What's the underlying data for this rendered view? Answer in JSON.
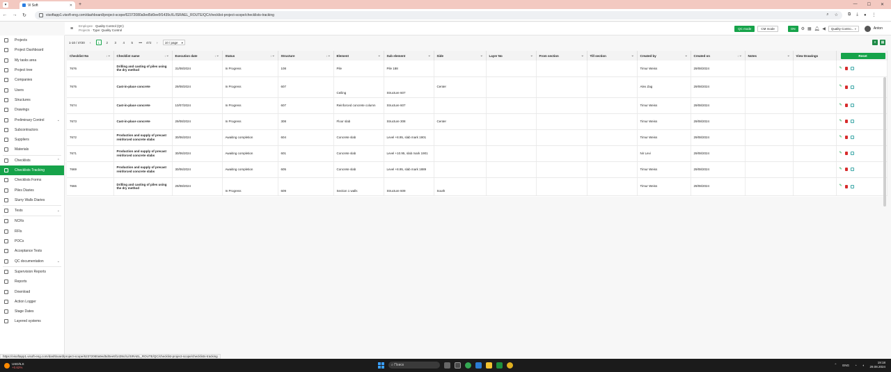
{
  "browser": {
    "tab_title": "Vi Soft",
    "url": "visoftapp1.visoft-eng.com/dashboard/project-scope/62372080a9ed5d0ee5f1439c/IL/ISRAEL_ROUTE/QC/checklist-project-scope/checklists-tracking",
    "status_url": "https://visoftapp1.visoft-eng.com/dashboard/project-scope/62372080a9ed5d0ee5f1439c/IL/ISRAEL_ROUTE/QC/checklist-project-scope/checklists-tracking"
  },
  "header": {
    "crumb_top_prefix": "Employee",
    "crumb_top": "Quality Control (QC)",
    "crumb_bottom_prefix": "Projects",
    "crumb_bottom": "Type: Quality Control",
    "qc_mode": "QC mode",
    "cm_mode": "CM mode",
    "on_label": "ON",
    "project_select": "Quality Contro...",
    "user": "Anton"
  },
  "sidebar": {
    "items": [
      {
        "label": "Projects"
      },
      {
        "label": "Project Dashboard"
      },
      {
        "label": "My tasks area"
      },
      {
        "label": "Project tree"
      },
      {
        "label": "Companies"
      },
      {
        "label": "Users"
      },
      {
        "label": "Structures"
      },
      {
        "label": "Drawings"
      },
      {
        "label": "Preliminary Control"
      },
      {
        "label": "Subcontractors"
      },
      {
        "label": "Suppliers"
      },
      {
        "label": "Materials"
      },
      {
        "label": "Checklists"
      },
      {
        "label": "Checklists Tracking"
      },
      {
        "label": "Checklists Forms"
      },
      {
        "label": "Piles Diaries"
      },
      {
        "label": "Slurry Walls Diaries"
      },
      {
        "label": "Tests"
      },
      {
        "label": "NCRs"
      },
      {
        "label": "RFIs"
      },
      {
        "label": "POCs"
      },
      {
        "label": "Acceptance Tests"
      },
      {
        "label": "QC documentation"
      },
      {
        "label": "Supervision Reports"
      },
      {
        "label": "Reports"
      },
      {
        "label": "Download"
      },
      {
        "label": "Action Logger"
      },
      {
        "label": "Stage Dates"
      },
      {
        "label": "Layered systems"
      }
    ]
  },
  "pagination": {
    "range": "1-10 / 4720",
    "pages": [
      "1",
      "2",
      "3",
      "4",
      "5",
      "•••",
      "472"
    ],
    "page_size": "10 / page"
  },
  "table": {
    "headers": [
      "Checklist No",
      "Checklist name",
      "Execution date",
      "Status",
      "Structure",
      "Element",
      "Sub element",
      "Side",
      "Layer No",
      "From section",
      "Till section",
      "Created by",
      "Created on",
      "Notes",
      "View Drawings"
    ],
    "reset_label": "Reset",
    "rows": [
      {
        "no": "7676",
        "name": "Drilling and casting of piles using the dry method",
        "date": "31/08/2024",
        "status": "In Progress",
        "structure": "108",
        "element": "Pile",
        "sub": "Pile 188",
        "side": "",
        "layer": "",
        "from": "",
        "till": "",
        "by": "Timur Weiss",
        "on": "29/08/2024",
        "notes": ""
      },
      {
        "no": "7675",
        "name": "Cast-in-place concrete",
        "date": "29/08/2024",
        "status": "In Progress",
        "structure": "607",
        "element": "Ceiling",
        "sub": "Structure 607",
        "side": "Center",
        "layer": "",
        "from": "",
        "till": "",
        "by": "Alex Zag",
        "on": "29/08/2024",
        "notes": ""
      },
      {
        "no": "7674",
        "name": "Cast-in-place concrete",
        "date": "10/07/2024",
        "status": "In Progress",
        "structure": "607",
        "element": "Reinforced concrete column",
        "sub": "Structure 607",
        "side": "",
        "layer": "",
        "from": "",
        "till": "",
        "by": "Timur Weiss",
        "on": "29/08/2024",
        "notes": ""
      },
      {
        "no": "7673",
        "name": "Cast-in-place concrete",
        "date": "29/08/2024",
        "status": "In Progress",
        "structure": "308",
        "element": "Floor slab",
        "sub": "Structure 308",
        "side": "Center",
        "layer": "",
        "from": "",
        "till": "",
        "by": "Timur Weiss",
        "on": "29/08/2024",
        "notes": ""
      },
      {
        "no": "7672",
        "name": "Production and supply of precast reinforced concrete slabs",
        "date": "30/06/2024",
        "status": "Awaiting completion",
        "structure": "604",
        "element": "Concrete slab",
        "sub": "Level +8.95, slab mark 1901",
        "side": "",
        "layer": "",
        "from": "",
        "till": "",
        "by": "Timur Weiss",
        "on": "29/08/2024",
        "notes": ""
      },
      {
        "no": "7671",
        "name": "Production and supply of precast reinforced concrete slabs",
        "date": "30/06/2024",
        "status": "Awaiting completion",
        "structure": "601",
        "element": "Concrete slab",
        "sub": "Level +10.95, slab mark 1901",
        "side": "",
        "layer": "",
        "from": "",
        "till": "",
        "by": "Nir Levi",
        "on": "29/08/2024",
        "notes": ""
      },
      {
        "no": "7669",
        "name": "Production and supply of precast reinforced concrete slabs",
        "date": "30/06/2024",
        "status": "Awaiting completion",
        "structure": "605",
        "element": "Concrete slab",
        "sub": "Level +8.95, slab mark 1889",
        "side": "",
        "layer": "",
        "from": "",
        "till": "",
        "by": "Timur Weiss",
        "on": "29/08/2024",
        "notes": ""
      },
      {
        "no": "7666",
        "name": "Drilling and casting of piles using the dry method",
        "date": "29/08/2024",
        "status": "In Progress",
        "structure": "609",
        "element": "Section 1 walls",
        "sub": "Structure 609",
        "side": "South",
        "layer": "",
        "from": "",
        "till": "",
        "by": "Timur Weiss",
        "on": "29/08/2024",
        "notes": ""
      }
    ]
  },
  "taskbar": {
    "ticker": "USD/ILS",
    "ticker_change": "+0.62%",
    "search": "Поиск",
    "lang": "ENG",
    "time": "19:18",
    "date": "29.08.2024"
  },
  "colors": {
    "accent": "#16a34a",
    "delete": "#d72c2c"
  }
}
